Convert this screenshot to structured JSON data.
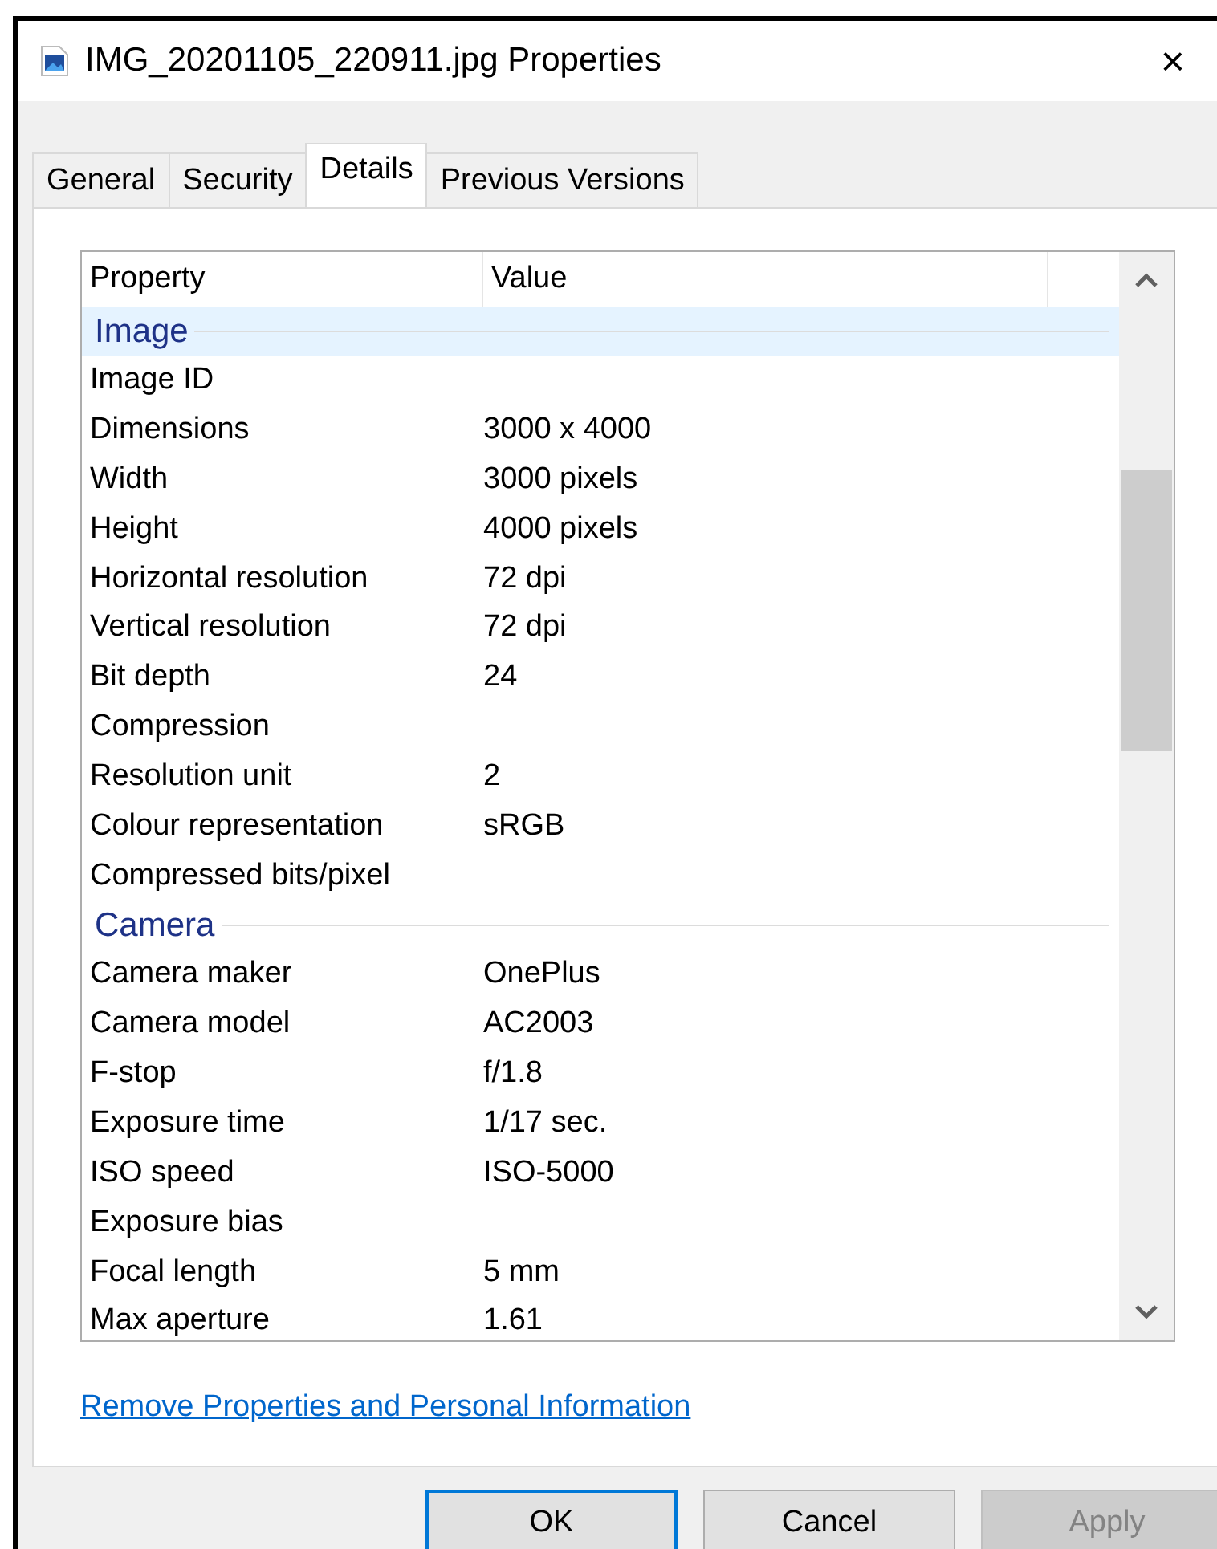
{
  "window": {
    "title": "IMG_20201105_220911.jpg Properties",
    "close": "×"
  },
  "tabs": [
    {
      "label": "General",
      "selected": false
    },
    {
      "label": "Security",
      "selected": false
    },
    {
      "label": "Details",
      "selected": true
    },
    {
      "label": "Previous Versions",
      "selected": false
    }
  ],
  "list": {
    "columns": [
      "Property",
      "Value"
    ],
    "rows": [
      {
        "kind": "group",
        "label": "Image",
        "selected": true
      },
      {
        "kind": "property",
        "property": "Image ID",
        "selected": false
      },
      {
        "kind": "property",
        "property": "Dimensions",
        "value": "3000 x 4000",
        "selected": false
      },
      {
        "kind": "property",
        "property": "Width",
        "value": "3000 pixels",
        "selected": false
      },
      {
        "kind": "property",
        "property": "Height",
        "value": "4000 pixels",
        "selected": false
      },
      {
        "kind": "property",
        "property": "Horizontal resolution",
        "value": "72 dpi",
        "selected": false
      },
      {
        "kind": "property",
        "property": "Vertical resolution",
        "value": "72 dpi",
        "selected": false
      },
      {
        "kind": "property",
        "property": "Bit depth",
        "value": "24",
        "selected": false
      },
      {
        "kind": "property",
        "property": "Compression",
        "selected": false
      },
      {
        "kind": "property",
        "property": "Resolution unit",
        "value": "2",
        "selected": false
      },
      {
        "kind": "property",
        "property": "Colour representation",
        "value": "sRGB",
        "selected": false
      },
      {
        "kind": "property",
        "property": "Compressed bits/pixel",
        "selected": false
      },
      {
        "kind": "group",
        "label": "Camera",
        "selected": false
      },
      {
        "kind": "property",
        "property": "Camera maker",
        "value": "OnePlus",
        "selected": false
      },
      {
        "kind": "property",
        "property": "Camera model",
        "value": "AC2003",
        "selected": false
      },
      {
        "kind": "property",
        "property": "F-stop",
        "value": "f/1.8",
        "selected": false
      },
      {
        "kind": "property",
        "property": "Exposure time",
        "value": "1/17 sec.",
        "selected": false
      },
      {
        "kind": "property",
        "property": "ISO speed",
        "value": "ISO-5000",
        "selected": false
      },
      {
        "kind": "property",
        "property": "Exposure bias",
        "selected": false
      },
      {
        "kind": "property",
        "property": "Focal length",
        "value": "5 mm",
        "selected": false
      },
      {
        "kind": "property",
        "property": "Max aperture",
        "value": "1.61",
        "selected": false
      }
    ]
  },
  "link": "Remove Properties and Personal Information",
  "buttons": [
    {
      "label": "OK",
      "default": true,
      "disabled": false
    },
    {
      "label": "Cancel",
      "default": false,
      "disabled": false
    },
    {
      "label": "Apply",
      "default": false,
      "disabled": true
    }
  ]
}
